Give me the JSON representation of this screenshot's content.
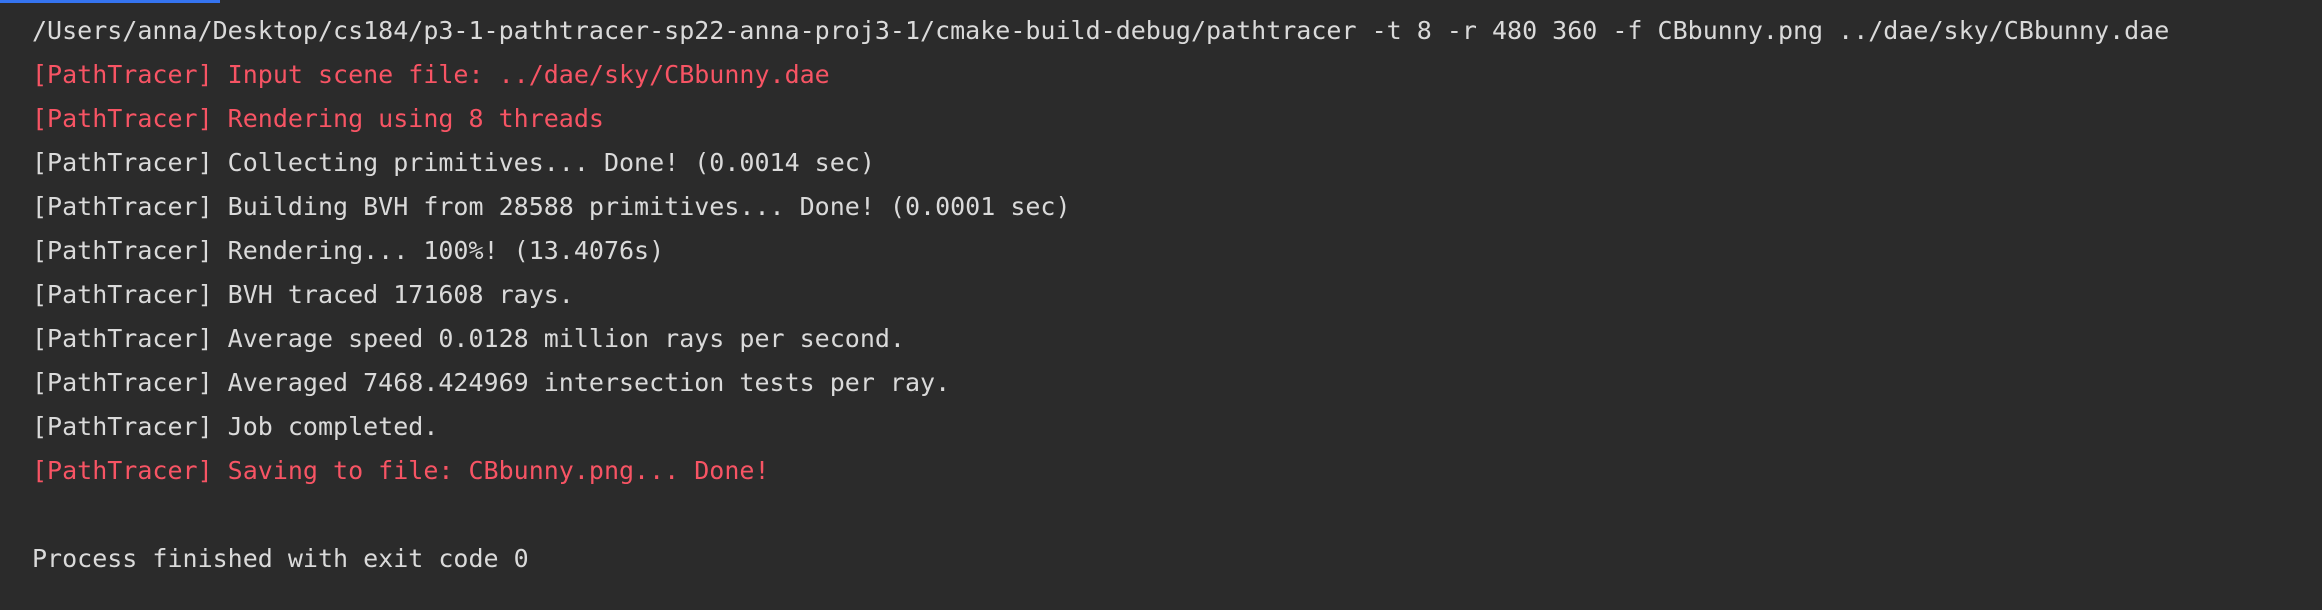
{
  "colors": {
    "background": "#2b2b2b",
    "stdout": "#dadada",
    "stderr": "#f75464",
    "tab_indicator": "#3574f0"
  },
  "console": {
    "command": "/Users/anna/Desktop/cs184/p3-1-pathtracer-sp22-anna-proj3-1/cmake-build-debug/pathtracer -t 8 -r 480 360 -f CBbunny.png ../dae/sky/CBbunny.dae",
    "lines": [
      "[PathTracer] Input scene file: ../dae/sky/CBbunny.dae",
      "[PathTracer] Rendering using 8 threads",
      "[PathTracer] Collecting primitives... Done! (0.0014 sec)",
      "[PathTracer] Building BVH from 28588 primitives... Done! (0.0001 sec)",
      "[PathTracer] Rendering... 100%! (13.4076s)",
      "[PathTracer] BVH traced 171608 rays.",
      "[PathTracer] Average speed 0.0128 million rays per second.",
      "[PathTracer] Averaged 7468.424969 intersection tests per ray.",
      "[PathTracer] Job completed.",
      "[PathTracer] Saving to file: CBbunny.png... Done!"
    ],
    "exit_message": "Process finished with exit code 0"
  }
}
